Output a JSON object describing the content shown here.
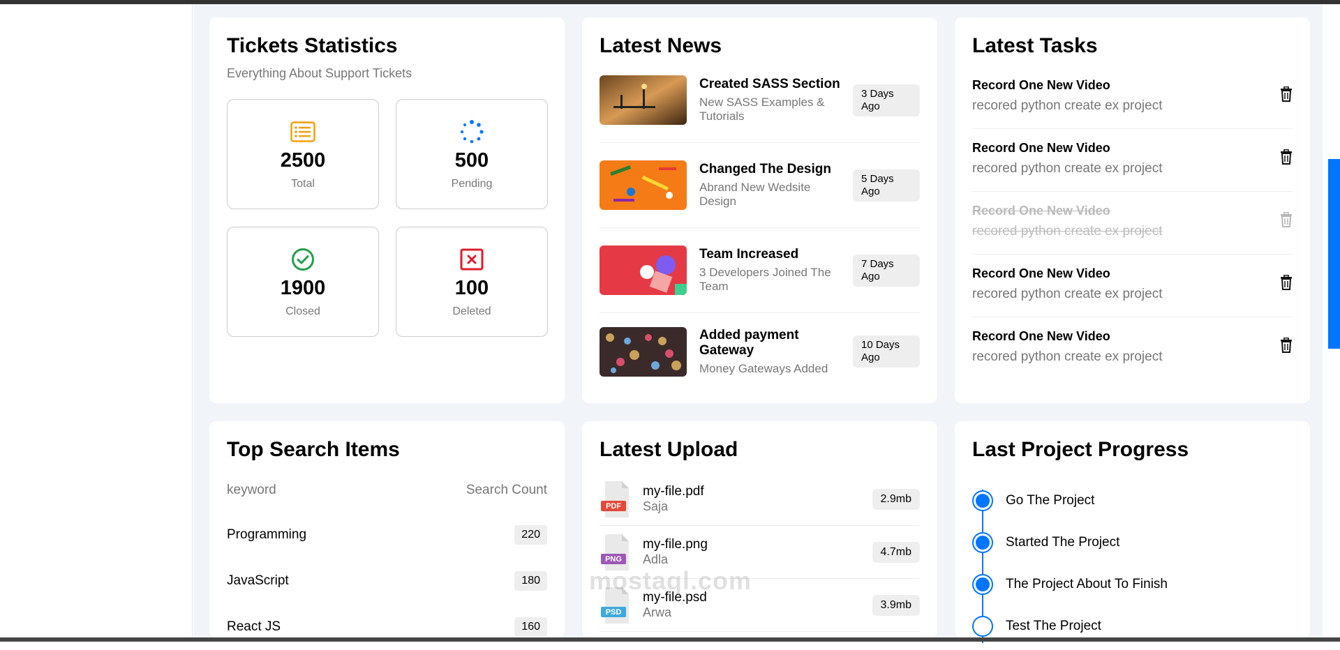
{
  "tickets": {
    "title": "Tickets Statistics",
    "subtitle": "Everything About Support Tickets",
    "items": [
      {
        "value": "2500",
        "label": "Total",
        "icon": "list-icon",
        "color": "#f59e0b"
      },
      {
        "value": "500",
        "label": "Pending",
        "icon": "spinner-icon",
        "color": "#0075ff"
      },
      {
        "value": "1900",
        "label": "Closed",
        "icon": "check-circle-icon",
        "color": "#22a04b"
      },
      {
        "value": "100",
        "label": "Deleted",
        "icon": "close-square-icon",
        "color": "#e11d2a"
      }
    ]
  },
  "news": {
    "title": "Latest News",
    "items": [
      {
        "title": "Created SASS Section",
        "desc": "New SASS Examples & Tutorials",
        "date": "3 Days Ago"
      },
      {
        "title": "Changed The Design",
        "desc": "Abrand New Wedsite Design",
        "date": "5 Days Ago"
      },
      {
        "title": "Team Increased",
        "desc": "3 Developers Joined The Team",
        "date": "7 Days Ago"
      },
      {
        "title": "Added payment Gateway",
        "desc": "Money Gateways Added",
        "date": "10 Days Ago"
      }
    ]
  },
  "tasks": {
    "title": "Latest Tasks",
    "items": [
      {
        "title": "Record One New Video",
        "desc": "recored python create ex project",
        "done": false
      },
      {
        "title": "Record One New Video",
        "desc": "recored python create ex project",
        "done": false
      },
      {
        "title": "Record One New Video",
        "desc": "recored python create ex project",
        "done": true
      },
      {
        "title": "Record One New Video",
        "desc": "recored python create ex project",
        "done": false
      },
      {
        "title": "Record One New Video",
        "desc": "recored python create ex project",
        "done": false
      }
    ]
  },
  "search": {
    "title": "Top Search Items",
    "col_keyword": "keyword",
    "col_count": "Search Count",
    "rows": [
      {
        "keyword": "Programming",
        "count": "220"
      },
      {
        "keyword": "JavaScript",
        "count": "180"
      },
      {
        "keyword": "React JS",
        "count": "160"
      }
    ]
  },
  "upload": {
    "title": "Latest Upload",
    "files": [
      {
        "name": "my-file.pdf",
        "owner": "Saja",
        "size": "2.9mb",
        "type": "PDF",
        "color": "#e4483b"
      },
      {
        "name": "my-file.png",
        "owner": "Adla",
        "size": "4.7mb",
        "type": "PNG",
        "color": "#9b59b6"
      },
      {
        "name": "my-file.psd",
        "owner": "Arwa",
        "size": "3.9mb",
        "type": "PSD",
        "color": "#3fa9dc"
      }
    ]
  },
  "progress": {
    "title": "Last Project Progress",
    "steps": [
      {
        "label": "Go The Project",
        "done": true
      },
      {
        "label": "Started The Project",
        "done": true
      },
      {
        "label": "The Project About To Finish",
        "done": true
      },
      {
        "label": "Test The Project",
        "done": false
      }
    ]
  },
  "watermark": "mostaql.com"
}
